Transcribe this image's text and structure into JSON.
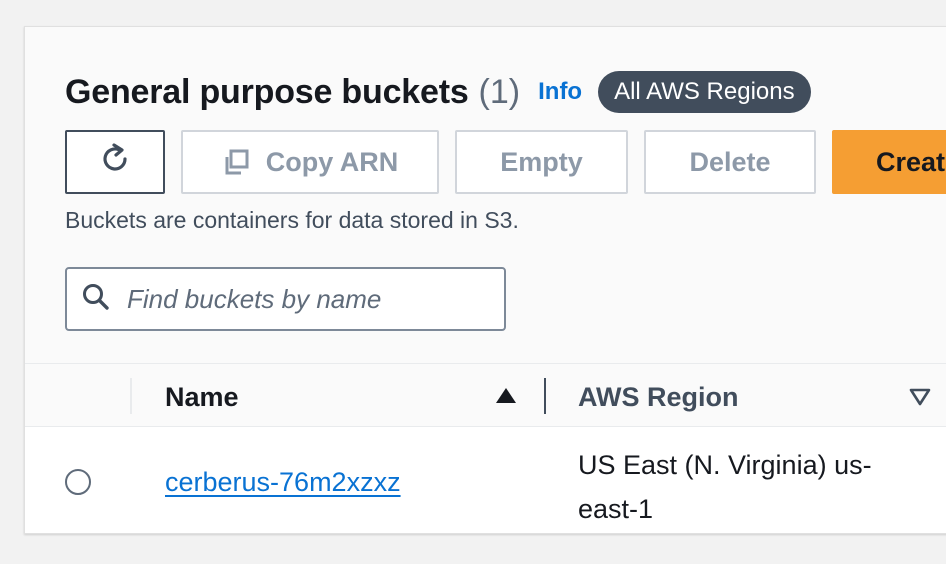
{
  "header": {
    "title": "General purpose buckets",
    "count": "(1)",
    "info_label": "Info",
    "region_badge": "All AWS Regions"
  },
  "toolbar": {
    "refresh_icon": "refresh-icon",
    "copy_arn_label": "Copy ARN",
    "copy_icon": "copy-icon",
    "empty_label": "Empty",
    "delete_label": "Delete",
    "create_label": "Creat"
  },
  "description": "Buckets are containers for data stored in S3.",
  "search": {
    "placeholder": "Find buckets by name",
    "value": "",
    "icon": "search-icon"
  },
  "table": {
    "columns": [
      {
        "label": "Name",
        "sort": "ascending"
      },
      {
        "label": "AWS Region",
        "sort": "descending-inactive"
      }
    ],
    "rows": [
      {
        "name": "cerberus-76m2xzxz",
        "region": "US East (N. Virginia) us-east-1",
        "selected": false
      }
    ]
  },
  "colors": {
    "accent": "#0972d3",
    "primary_button": "#f59e33",
    "badge": "#414d5c"
  }
}
